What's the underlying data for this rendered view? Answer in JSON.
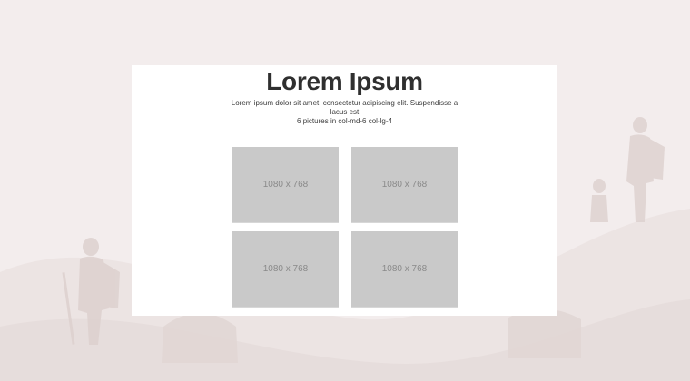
{
  "hero": {
    "title": "Lorem Ipsum",
    "description": "Lorem ipsum dolor sit amet, consectetur adipiscing elit. Suspendisse a lacus est",
    "subline": "6 pictures in col-md-6 col-lg-4"
  },
  "gallery": {
    "images": [
      {
        "label": "1080 x 768"
      },
      {
        "label": "1080 x 768"
      },
      {
        "label": "1080 x 768"
      },
      {
        "label": "1080 x 768"
      }
    ]
  },
  "colors": {
    "background": "#f3eded",
    "card": "#ffffff",
    "placeholder": "#c9c9c9",
    "placeholder_text": "#8a8a8a",
    "title": "#2f2f2f"
  }
}
